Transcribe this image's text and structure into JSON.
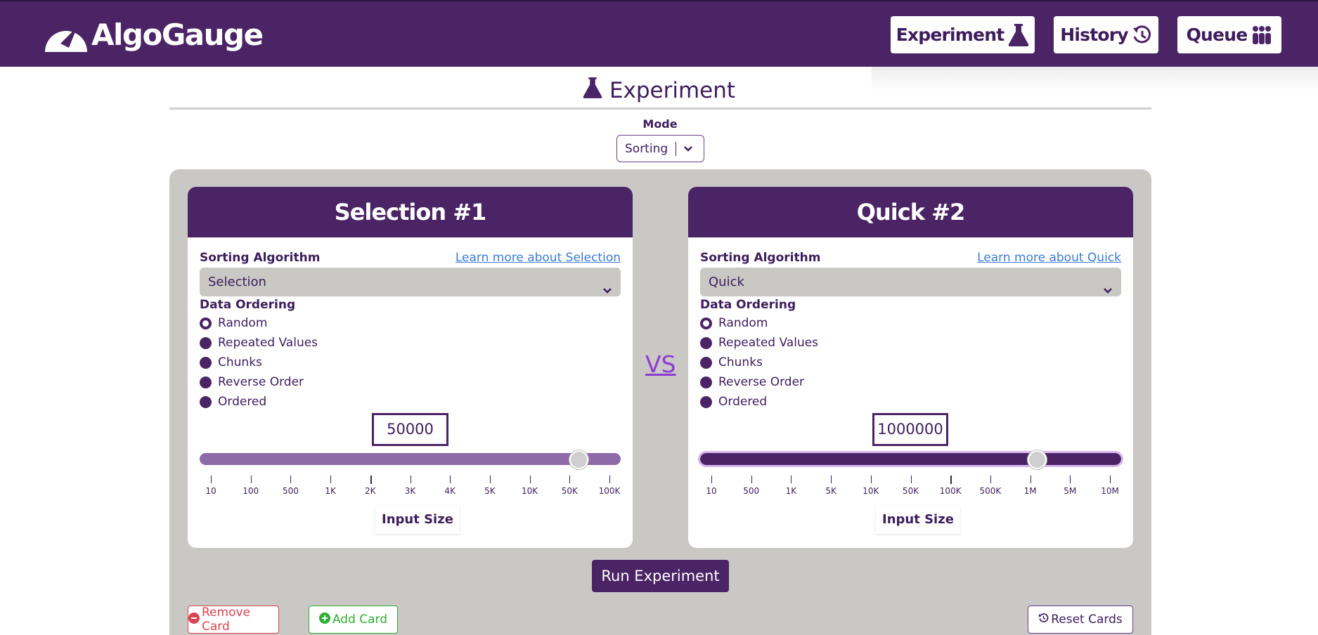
{
  "header": {
    "logo_text": "AlgoGauge",
    "nav": [
      {
        "label": "Experiment",
        "icon": "flask-icon"
      },
      {
        "label": "History",
        "icon": "history-icon"
      },
      {
        "label": "Queue",
        "icon": "queue-icon"
      }
    ]
  },
  "page": {
    "title": "Experiment",
    "mode_label": "Mode",
    "mode_value": "Sorting"
  },
  "cards": [
    {
      "title": "Selection #1",
      "algo_label": "Sorting Algorithm",
      "learn_more": "Learn more about Selection",
      "algo_value": "Selection",
      "ordering_label": "Data Ordering",
      "orderings": [
        "Random",
        "Repeated Values",
        "Chunks",
        "Reverse Order",
        "Ordered"
      ],
      "selected_ordering": "Random",
      "input_size": "50000",
      "slider_level": 0.9,
      "ticks": [
        "10",
        "100",
        "500",
        "1K",
        "2K",
        "3K",
        "4K",
        "5K",
        "10K",
        "50K",
        "100K"
      ],
      "input_size_label": "Input Size"
    },
    {
      "title": "Quick #2",
      "algo_label": "Sorting Algorithm",
      "learn_more": "Learn more about Quick",
      "algo_value": "Quick",
      "ordering_label": "Data Ordering",
      "orderings": [
        "Random",
        "Repeated Values",
        "Chunks",
        "Reverse Order",
        "Ordered"
      ],
      "selected_ordering": "Random",
      "input_size": "1000000",
      "slider_level": 0.8,
      "ticks": [
        "10",
        "500",
        "1K",
        "5K",
        "10K",
        "50K",
        "100K",
        "500K",
        "1M",
        "5M",
        "10M"
      ],
      "input_size_label": "Input Size"
    }
  ],
  "vs_label": "VS",
  "actions": {
    "run": "Run Experiment",
    "remove": "Remove Card",
    "add": "Add Card",
    "reset": "Reset Cards"
  },
  "colors": {
    "brand_purple": "#4b2466",
    "panel_gray": "#c9c8c4",
    "link_blue": "#3a7bd5",
    "vs_purple": "#8f3ad6",
    "remove_red": "#d94452",
    "add_green": "#2eae35"
  }
}
